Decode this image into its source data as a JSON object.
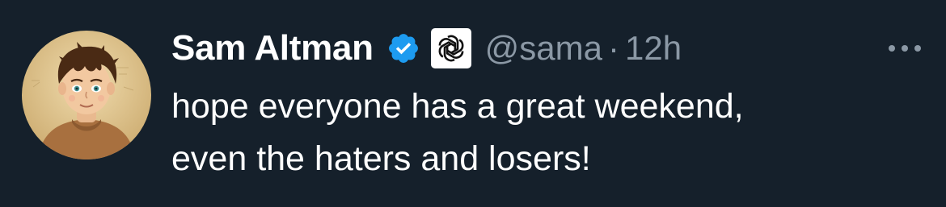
{
  "tweet": {
    "author_name": "Sam Altman",
    "handle": "@sama",
    "separator": "·",
    "time": "12h",
    "lines": [
      "hope everyone has a great weekend,",
      "even the haters and losers!"
    ]
  },
  "icons": {
    "verified": "verified-badge-icon",
    "affiliation": "openai-logo-icon",
    "more": "more-options-icon"
  },
  "colors": {
    "background": "#15202b",
    "text_primary": "#ffffff",
    "text_secondary": "#8b98a5",
    "verified_blue": "#1d9bf0"
  }
}
